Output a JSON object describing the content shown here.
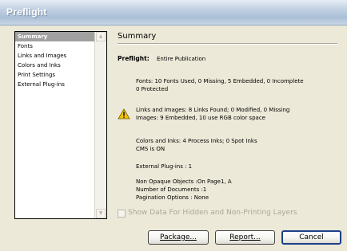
{
  "window": {
    "title": "Preflight"
  },
  "sidebar": {
    "items": [
      {
        "label": "Summary",
        "selected": true
      },
      {
        "label": "Fonts",
        "selected": false
      },
      {
        "label": "Links and Images",
        "selected": false
      },
      {
        "label": "Colors and Inks",
        "selected": false
      },
      {
        "label": "Print Settings",
        "selected": false
      },
      {
        "label": "External Plug-ins",
        "selected": false
      }
    ]
  },
  "main": {
    "title": "Summary",
    "preflight_label": "Preflight:",
    "preflight_value": "Entire Publication",
    "fonts_line1": "Fonts: 10 Fonts Used, 0 Missing, 5 Embedded, 0 Incomplete",
    "fonts_line2": "0 Protected",
    "links_line1": "Links and Images: 8 Links Found; 0 Modified, 0 Missing",
    "links_line2": "Images: 9 Embedded, 10 use RGB color space",
    "colors_line1": "Colors and Inks: 4 Process Inks; 0 Spot Inks",
    "colors_line2": "CMS is ON",
    "plugins_line": "External Plug-ins : 1",
    "nonopaque_line": "Non Opaque Objects :On Page1, A",
    "numdocs_line": "Number of Documents :1",
    "pagination_line": "Pagination Options : None",
    "warning_icon": "warning-triangle-icon"
  },
  "options": {
    "show_hidden_label": "Show Data For Hidden and Non-Printing Layers",
    "show_hidden_checked": false
  },
  "buttons": {
    "package": "Package...",
    "report": "Report...",
    "cancel": "Cancel"
  }
}
